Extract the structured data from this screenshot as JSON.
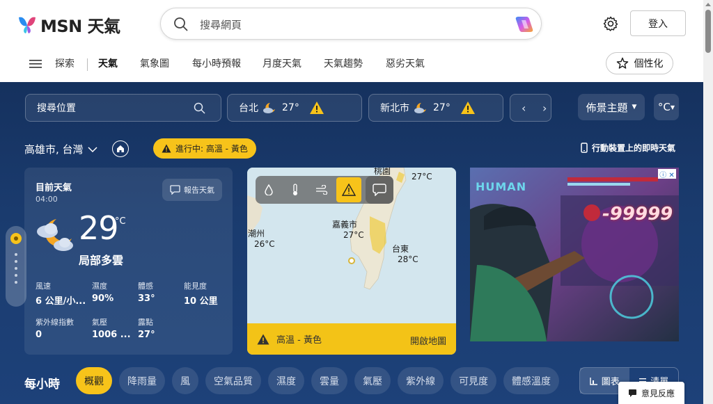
{
  "header": {
    "brand": "MSN 天氣",
    "search_placeholder": "搜尋網頁",
    "signin_label": "登入"
  },
  "nav": {
    "items": [
      "探索",
      "天氣",
      "氣象圖",
      "每小時預報",
      "月度天氣",
      "天氣趨勢",
      "惡劣天氣"
    ],
    "personalize_label": "個性化"
  },
  "locations": {
    "search_placeholder": "搜尋位置",
    "cities": [
      {
        "name": "台北",
        "temp": "27°"
      },
      {
        "name": "新北市",
        "temp": "27°"
      }
    ],
    "theme_label": "佈景主題",
    "unit_label": "°C"
  },
  "current_location": {
    "name": "高雄市, 台灣",
    "alert_text": "進行中: 高溫 - 黃色",
    "mobile_link": "行動裝置上的即時天氣"
  },
  "current": {
    "title": "目前天氣",
    "time": "04:00",
    "report_label": "報告天氣",
    "temp": "29",
    "unit": "°C",
    "condition": "局部多雲",
    "stats": [
      {
        "label": "風速",
        "value": "6 公里/小..."
      },
      {
        "label": "濕度",
        "value": "90%"
      },
      {
        "label": "體感",
        "value": "33°"
      },
      {
        "label": "能見度",
        "value": "10 公里"
      },
      {
        "label": "紫外線指數",
        "value": "0"
      },
      {
        "label": "氣壓",
        "value": "1006 ..."
      },
      {
        "label": "露點",
        "value": "27°"
      }
    ]
  },
  "map": {
    "labels": [
      {
        "name": "桃園",
        "temp": ""
      },
      {
        "name": "",
        "temp": "27°C"
      },
      {
        "name": "潮州",
        "temp": "26°C"
      },
      {
        "name": "嘉義市",
        "temp": "27°C"
      },
      {
        "name": "台東",
        "temp": "28°C"
      }
    ],
    "footer_alert": "高溫 - 黃色",
    "open_map_label": "開啟地圖"
  },
  "ad": {
    "title": "HUMAN",
    "damage_text": "-99999"
  },
  "hourly": {
    "title": "每小時",
    "tabs": [
      "概觀",
      "降雨量",
      "風",
      "空氣品質",
      "濕度",
      "雲量",
      "氣壓",
      "紫外線",
      "可見度",
      "體感溫度"
    ],
    "view_chart": "圖表",
    "view_list": "清單"
  },
  "feedback_label": "意見反應",
  "colors": {
    "accent_yellow": "#f7c31a",
    "bg_blue": "#1a3b6e"
  }
}
